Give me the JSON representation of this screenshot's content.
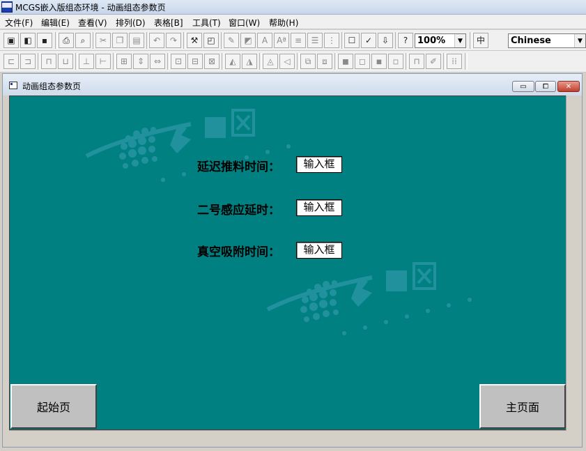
{
  "app": {
    "title": "MCGS嵌入版组态环境 - 动画组态参数页"
  },
  "menu": [
    "文件(F)",
    "编辑(E)",
    "查看(V)",
    "排列(D)",
    "表格[B]",
    "工具(T)",
    "窗口(W)",
    "帮助(H)"
  ],
  "toolbar": {
    "zoom_value": "100%",
    "language_value": "Chinese",
    "icons_row1": [
      "new-window-icon",
      "component-icon",
      "save-icon",
      "print-icon",
      "print-preview-icon",
      "cut-icon",
      "copy-icon",
      "paste-icon",
      "undo-icon",
      "redo-icon",
      "tools-icon",
      "property-icon",
      "line-color-icon",
      "fill-color-icon",
      "font-color-icon",
      "font-icon",
      "line-style-icon",
      "line-width-icon",
      "grid-icon",
      "object-properties-icon",
      "check-icon",
      "download-icon",
      "help-icon",
      "language-icon"
    ],
    "icons_row2": [
      "align-left-icon",
      "align-right-icon",
      "align-top-icon",
      "align-bottom-icon",
      "center-vertical-icon",
      "center-horizontal-icon",
      "center-both-icon",
      "same-height-icon",
      "same-width-icon",
      "same-size-icon",
      "group-icon",
      "ungroup-icon",
      "bring-front-icon",
      "rotate-left-icon",
      "rotate-right-icon",
      "flip-horizontal-icon",
      "flip-vertical-icon",
      "lock-icon",
      "unlock-icon",
      "layer-front-icon",
      "layer-back-icon",
      "layer-up-icon",
      "layer-down-icon",
      "lock-object-icon",
      "fix-object-icon",
      "grid-dots-icon"
    ]
  },
  "child_window": {
    "title": "动画组态参数页"
  },
  "canvas": {
    "background": "#008080",
    "rows": [
      {
        "label": "延迟推料时间：",
        "input": "输入框"
      },
      {
        "label": "二号感应延时：",
        "input": "输入框"
      },
      {
        "label": "真空吸附时间：",
        "input": "输入框"
      }
    ],
    "start_button": "起始页",
    "home_button": "主页面"
  }
}
